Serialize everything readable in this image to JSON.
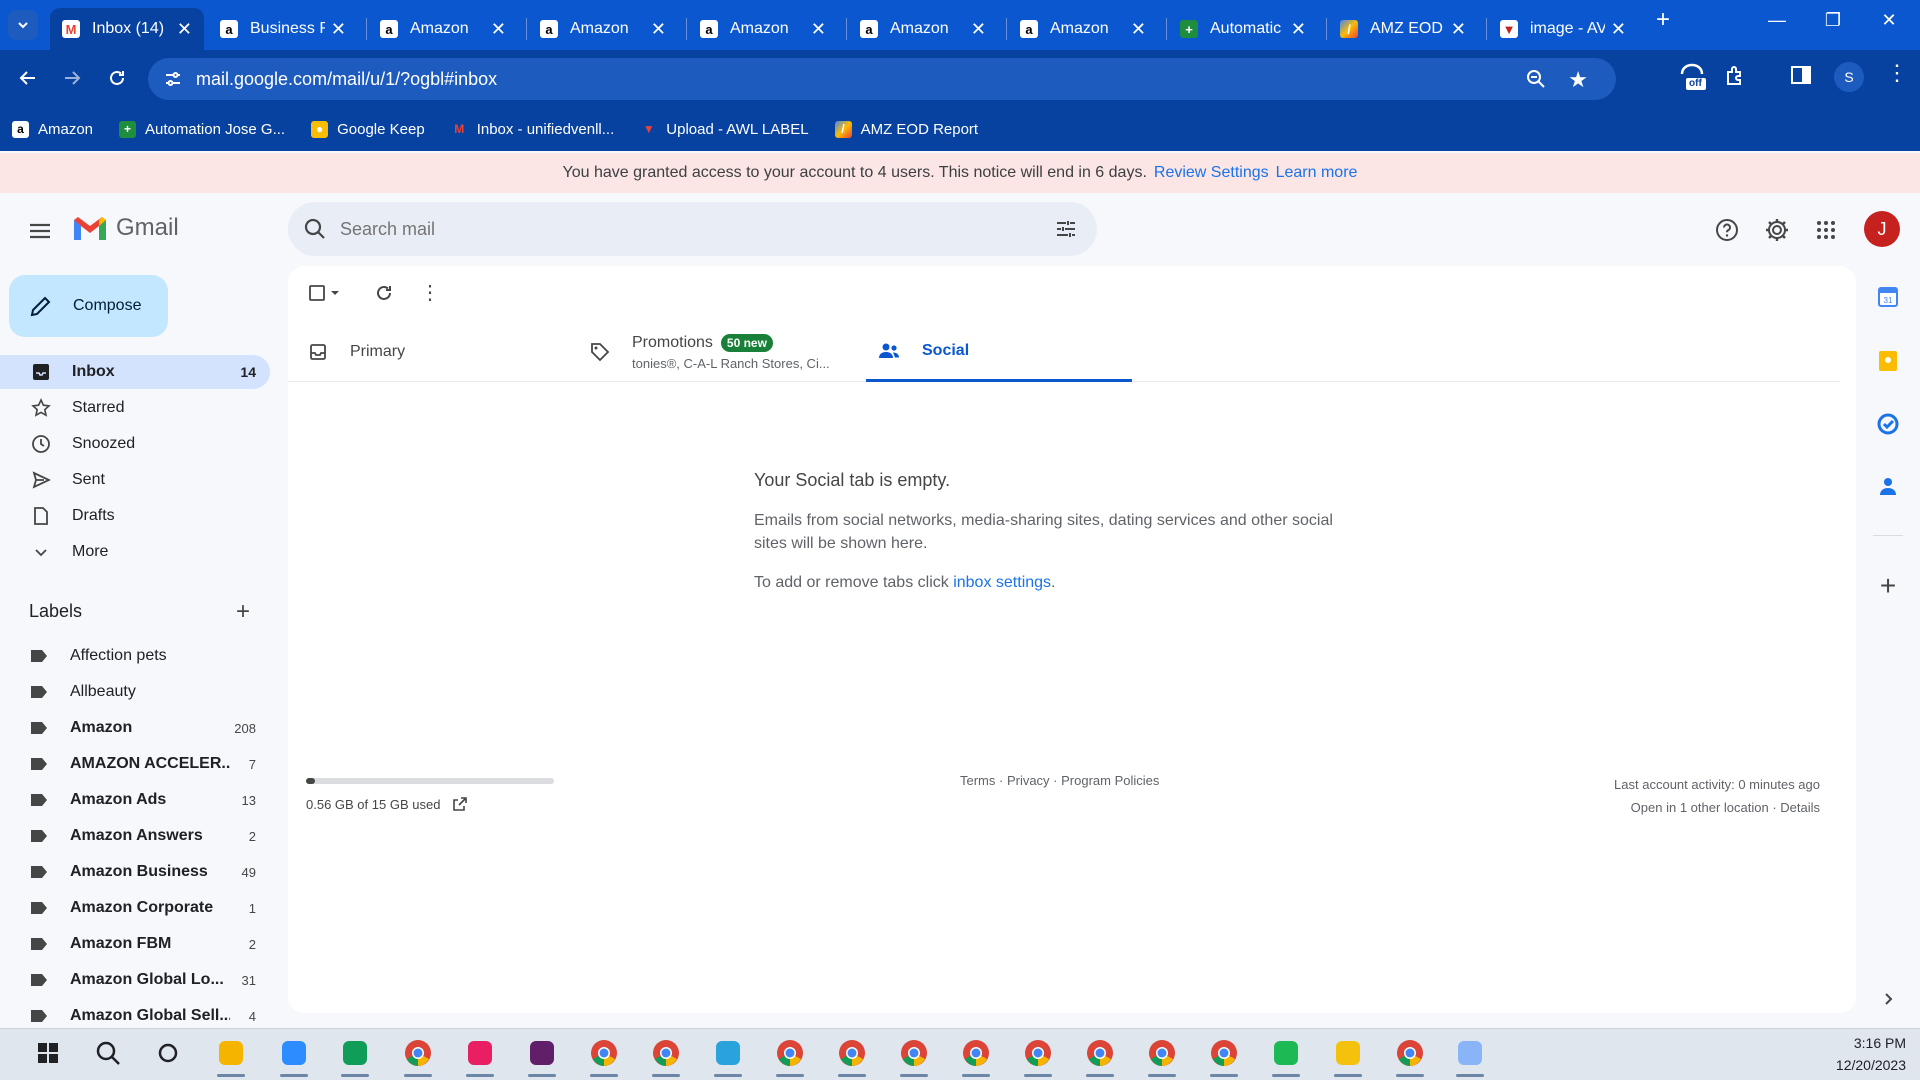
{
  "browser": {
    "tabs": [
      {
        "title": "Inbox (14)",
        "icon": "gmail-icon"
      },
      {
        "title": "Business R",
        "icon": "amazon-icon"
      },
      {
        "title": "Amazon",
        "icon": "amazon-icon"
      },
      {
        "title": "Amazon",
        "icon": "amazon-icon"
      },
      {
        "title": "Amazon",
        "icon": "amazon-icon"
      },
      {
        "title": "Amazon",
        "icon": "amazon-icon"
      },
      {
        "title": "Amazon",
        "icon": "amazon-icon"
      },
      {
        "title": "Automatic",
        "icon": "sheets-icon"
      },
      {
        "title": "AMZ EOD",
        "icon": "amz-eod-icon"
      },
      {
        "title": "image - AV",
        "icon": "awl-icon"
      }
    ],
    "url": "mail.google.com/mail/u/1/?ogbl#inbox",
    "profile_initial": "S",
    "extension_badge": "off",
    "bookmarks": [
      {
        "label": "Amazon",
        "icon": "amazon-icon"
      },
      {
        "label": "Automation Jose G...",
        "icon": "sheets-icon"
      },
      {
        "label": "Google Keep",
        "icon": "keep-icon"
      },
      {
        "label": "Inbox - unifiedvenll...",
        "icon": "gmail-icon"
      },
      {
        "label": "Upload - AWL LABEL",
        "icon": "awl-icon"
      },
      {
        "label": "AMZ EOD Report",
        "icon": "amz-eod-icon"
      }
    ],
    "colors": {
      "chrome_blue": "#0b57d0",
      "chrome_dark": "#0842a0"
    }
  },
  "notice": {
    "text": "You have granted access to your account to 4 users. This notice will end in 6 days.",
    "review": "Review Settings",
    "learn": "Learn more"
  },
  "gmail": {
    "wordmark": "Gmail",
    "search_placeholder": "Search mail",
    "avatar_initial": "J",
    "compose": "Compose",
    "nav": [
      {
        "label": "Inbox",
        "count": "14",
        "icon": "inbox-icon"
      },
      {
        "label": "Starred",
        "count": "",
        "icon": "star-icon"
      },
      {
        "label": "Snoozed",
        "count": "",
        "icon": "clock-icon"
      },
      {
        "label": "Sent",
        "count": "",
        "icon": "send-icon"
      },
      {
        "label": "Drafts",
        "count": "",
        "icon": "draft-icon"
      },
      {
        "label": "More",
        "count": "",
        "icon": "chevron-down-icon"
      }
    ],
    "labels_header": "Labels",
    "labels": [
      {
        "name": "Affection pets",
        "count": ""
      },
      {
        "name": "Allbeauty",
        "count": ""
      },
      {
        "name": "Amazon",
        "count": "208"
      },
      {
        "name": "AMAZON ACCELER...",
        "count": "7"
      },
      {
        "name": "Amazon Ads",
        "count": "13"
      },
      {
        "name": "Amazon Answers",
        "count": "2"
      },
      {
        "name": "Amazon Business",
        "count": "49"
      },
      {
        "name": "Amazon Corporate",
        "count": "1"
      },
      {
        "name": "Amazon FBM",
        "count": "2"
      },
      {
        "name": "Amazon Global Lo...",
        "count": "31"
      },
      {
        "name": "Amazon Global Sell...",
        "count": "4"
      }
    ],
    "tabs": {
      "primary": "Primary",
      "promotions": "Promotions",
      "promotions_badge": "50 new",
      "promotions_sub": "tonies®, C-A-L Ranch Stores, Ci...",
      "social": "Social"
    },
    "empty": {
      "title": "Your Social tab is empty.",
      "body": "Emails from social networks, media-sharing sites, dating services and other social sites will be shown here.",
      "settings_prefix": "To add or remove tabs click",
      "settings_link": "inbox settings",
      "settings_suffix": "."
    },
    "storage": {
      "text": "0.56 GB of 15 GB used",
      "fraction": 0.037
    },
    "footer": "Terms · Privacy · Program Policies",
    "activity_line1": "Last account activity: 0 minutes ago",
    "activity_line2": "Open in 1 other location · Details"
  },
  "taskbar": {
    "time": "3:16 PM",
    "date": "12/20/2023",
    "apps": [
      "windows-start-icon",
      "search-icon",
      "task-view-icon",
      "file-explorer-icon",
      "zoom-icon",
      "edge-icon",
      "chrome-icon",
      "snipping-tool-icon",
      "slack-icon",
      "chrome-icon",
      "chrome-icon",
      "telegram-icon",
      "chrome-icon",
      "chrome-icon",
      "chrome-icon",
      "chrome-icon",
      "chrome-icon",
      "chrome-icon",
      "chrome-icon",
      "chrome-icon",
      "spotify-icon",
      "sticky-notes-icon",
      "chrome-icon",
      "paint-icon"
    ]
  }
}
